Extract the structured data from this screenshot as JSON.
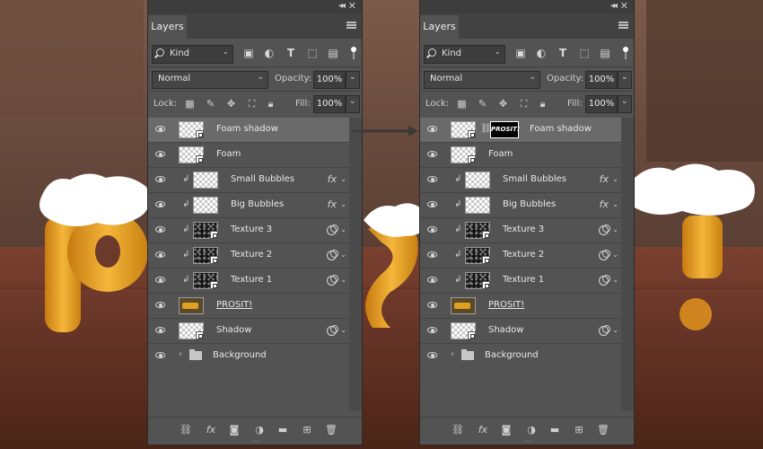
{
  "colors": {
    "panel": "#535353",
    "selected_row": "#6a6a6a",
    "header": "#3c3c3c",
    "wood": "#6b3a2a"
  },
  "panels": [
    {
      "tab": "Layers",
      "kind": "Kind",
      "blend_mode": "Normal",
      "opacity_label": "Opacity:",
      "opacity": "100%",
      "lock_label": "Lock:",
      "fill_label": "Fill:",
      "fill": "100%",
      "layers": [
        {
          "name": "Foam shadow",
          "thumb": "smart",
          "selected": true
        },
        {
          "name": "Foam",
          "thumb": "smart"
        },
        {
          "name": "Small Bubbles",
          "thumb": "checker",
          "clip": true,
          "badge": "fx"
        },
        {
          "name": "Big Bubbles",
          "thumb": "checker",
          "clip": true,
          "badge": "fx"
        },
        {
          "name": "Texture 3",
          "thumb": "dark",
          "clip": true,
          "badge": "smartfilter"
        },
        {
          "name": "Texture 2",
          "thumb": "dark",
          "clip": true,
          "badge": "smartfilter"
        },
        {
          "name": "Texture 1",
          "thumb": "dark",
          "clip": true,
          "badge": "smartfilter"
        },
        {
          "name": "PROSIT!",
          "thumb": "gold",
          "underline": true
        },
        {
          "name": "Shadow",
          "thumb": "smart",
          "badge": "smartfilter"
        },
        {
          "name": "Background",
          "thumb": "folder"
        }
      ]
    },
    {
      "tab": "Layers",
      "kind": "Kind",
      "blend_mode": "Normal",
      "opacity_label": "Opacity:",
      "opacity": "100%",
      "lock_label": "Lock:",
      "fill_label": "Fill:",
      "fill": "100%",
      "mask_text": "PROSIT!",
      "layers": [
        {
          "name": "Foam shadow",
          "thumb": "smart",
          "selected": true,
          "mask": true
        },
        {
          "name": "Foam",
          "thumb": "smart"
        },
        {
          "name": "Small Bubbles",
          "thumb": "checker",
          "clip": true,
          "badge": "fx"
        },
        {
          "name": "Big Bubbles",
          "thumb": "checker",
          "clip": true,
          "badge": "fx"
        },
        {
          "name": "Texture 3",
          "thumb": "dark",
          "clip": true,
          "badge": "smartfilter"
        },
        {
          "name": "Texture 2",
          "thumb": "dark",
          "clip": true,
          "badge": "smartfilter"
        },
        {
          "name": "Texture 1",
          "thumb": "dark",
          "clip": true,
          "badge": "smartfilter"
        },
        {
          "name": "PROSIT!",
          "thumb": "gold",
          "underline": true
        },
        {
          "name": "Shadow",
          "thumb": "smart",
          "badge": "smartfilter"
        },
        {
          "name": "Background",
          "thumb": "folder"
        }
      ]
    }
  ]
}
